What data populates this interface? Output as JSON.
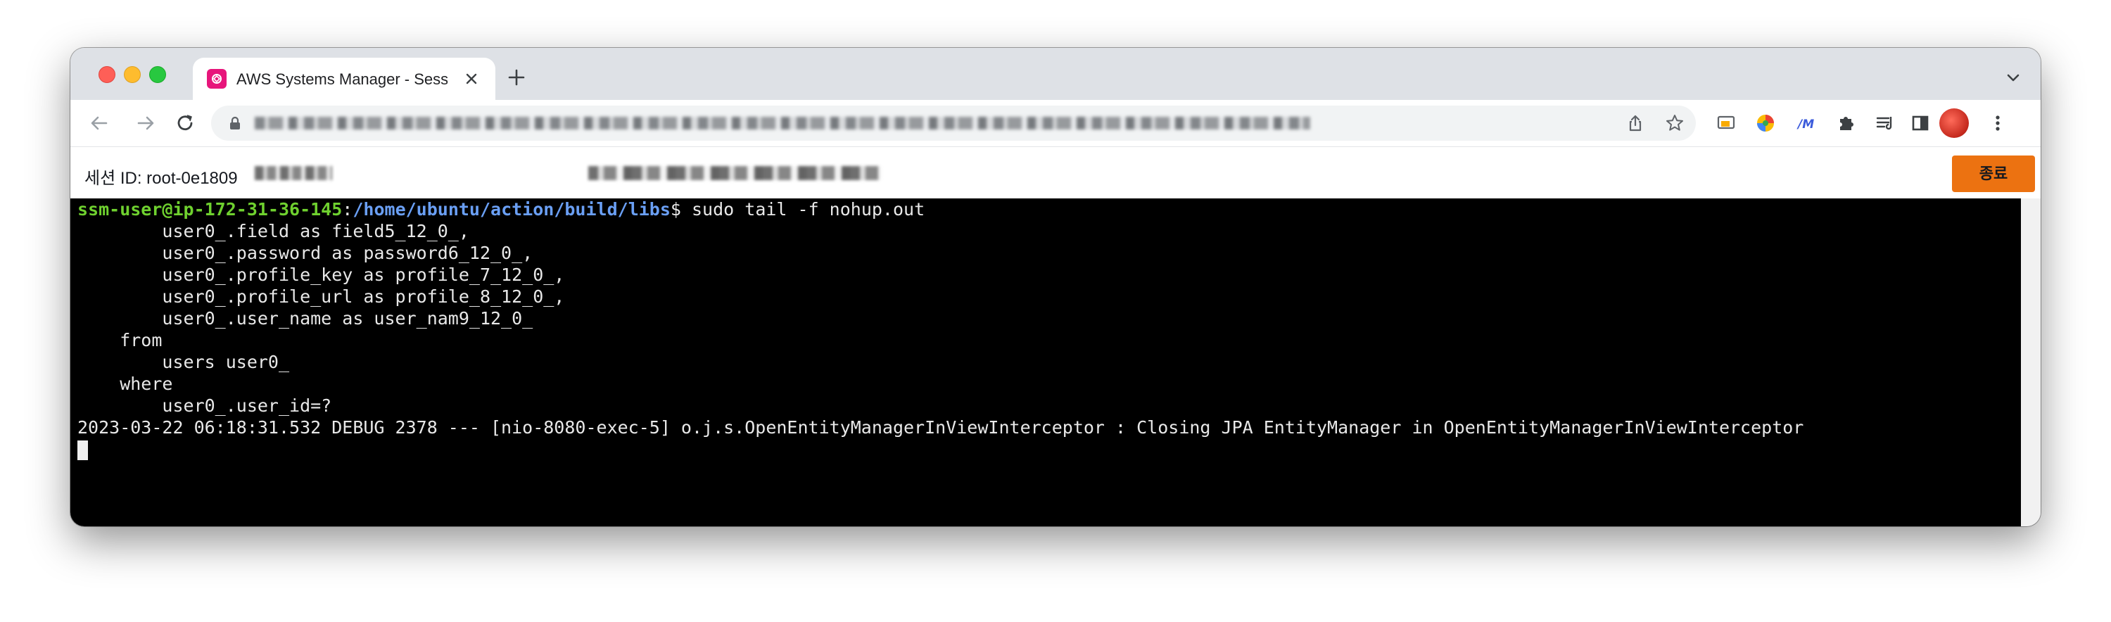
{
  "browser": {
    "tab": {
      "title": "AWS Systems Manager - Session Manager",
      "close_icon": "close-icon",
      "favicon": "aws-systems-manager-icon"
    },
    "new_tab_icon": "plus-icon",
    "tab_search_icon": "chevron-down-icon",
    "toolbar": {
      "back_icon": "arrow-left-icon",
      "forward_icon": "arrow-right-icon",
      "reload_icon": "reload-icon",
      "lock_icon": "lock-icon",
      "share_icon": "share-icon",
      "bookmark_icon": "star-icon",
      "extensions": [
        "cast-icon",
        "color-extension-icon",
        "translate-extension-icon",
        "puzzle-icon",
        "reading-list-icon",
        "side-panel-icon"
      ],
      "profile_icon": "avatar",
      "menu_icon": "kebab-menu-icon"
    }
  },
  "session": {
    "id_label": "세션 ID: root-0e1809",
    "end_button": "종료"
  },
  "terminal": {
    "prompt_user": "ssm-user@ip-172-31-36-145",
    "prompt_path": "/home/ubuntu/action/build/libs",
    "command": "$ sudo tail -f nohup.out",
    "lines": [
      "        user0_.field as field5_12_0_,",
      "        user0_.password as password6_12_0_,",
      "        user0_.profile_key as profile_7_12_0_,",
      "        user0_.profile_url as profile_8_12_0_,",
      "        user0_.user_name as user_nam9_12_0_",
      "    from",
      "        users user0_",
      "    where",
      "        user0_.user_id=?",
      "2023-03-22 06:18:31.532 DEBUG 2378 --- [nio-8080-exec-5] o.j.s.OpenEntityManagerInViewInterceptor : Closing JPA EntityManager in OpenEntityManagerInViewInterceptor"
    ]
  },
  "colors": {
    "prompt_user": "#6fd12f",
    "prompt_path": "#6a9ff4",
    "end_button": "#ec7211",
    "terminal_bg": "#000000"
  }
}
